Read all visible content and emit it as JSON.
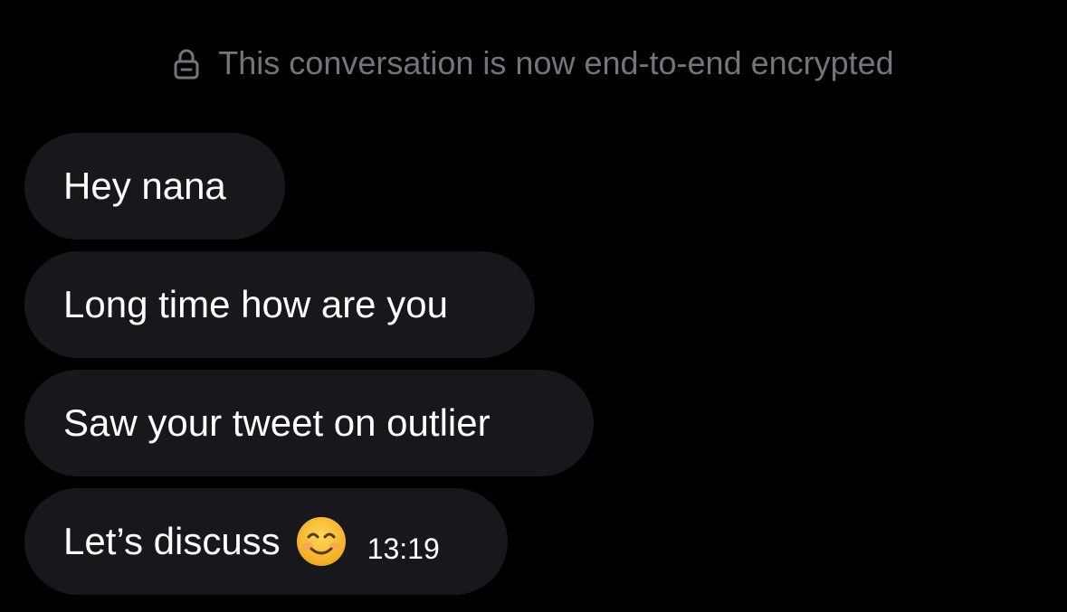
{
  "notice": {
    "icon": "lock-icon",
    "text": "This conversation is now end-to-end encrypted"
  },
  "messages": [
    {
      "text": "Hey nana"
    },
    {
      "text": "Long time how are you"
    },
    {
      "text": "Saw your tweet on outlier"
    },
    {
      "text": "Let’s discuss",
      "emoji": "smiling-face-icon",
      "timestamp": "13:19"
    }
  ],
  "colors": {
    "background": "#000000",
    "bubble": "#16181c",
    "notice_text": "#71767b",
    "message_text": "#ffffff",
    "emoji_face": "#f7c33a"
  }
}
